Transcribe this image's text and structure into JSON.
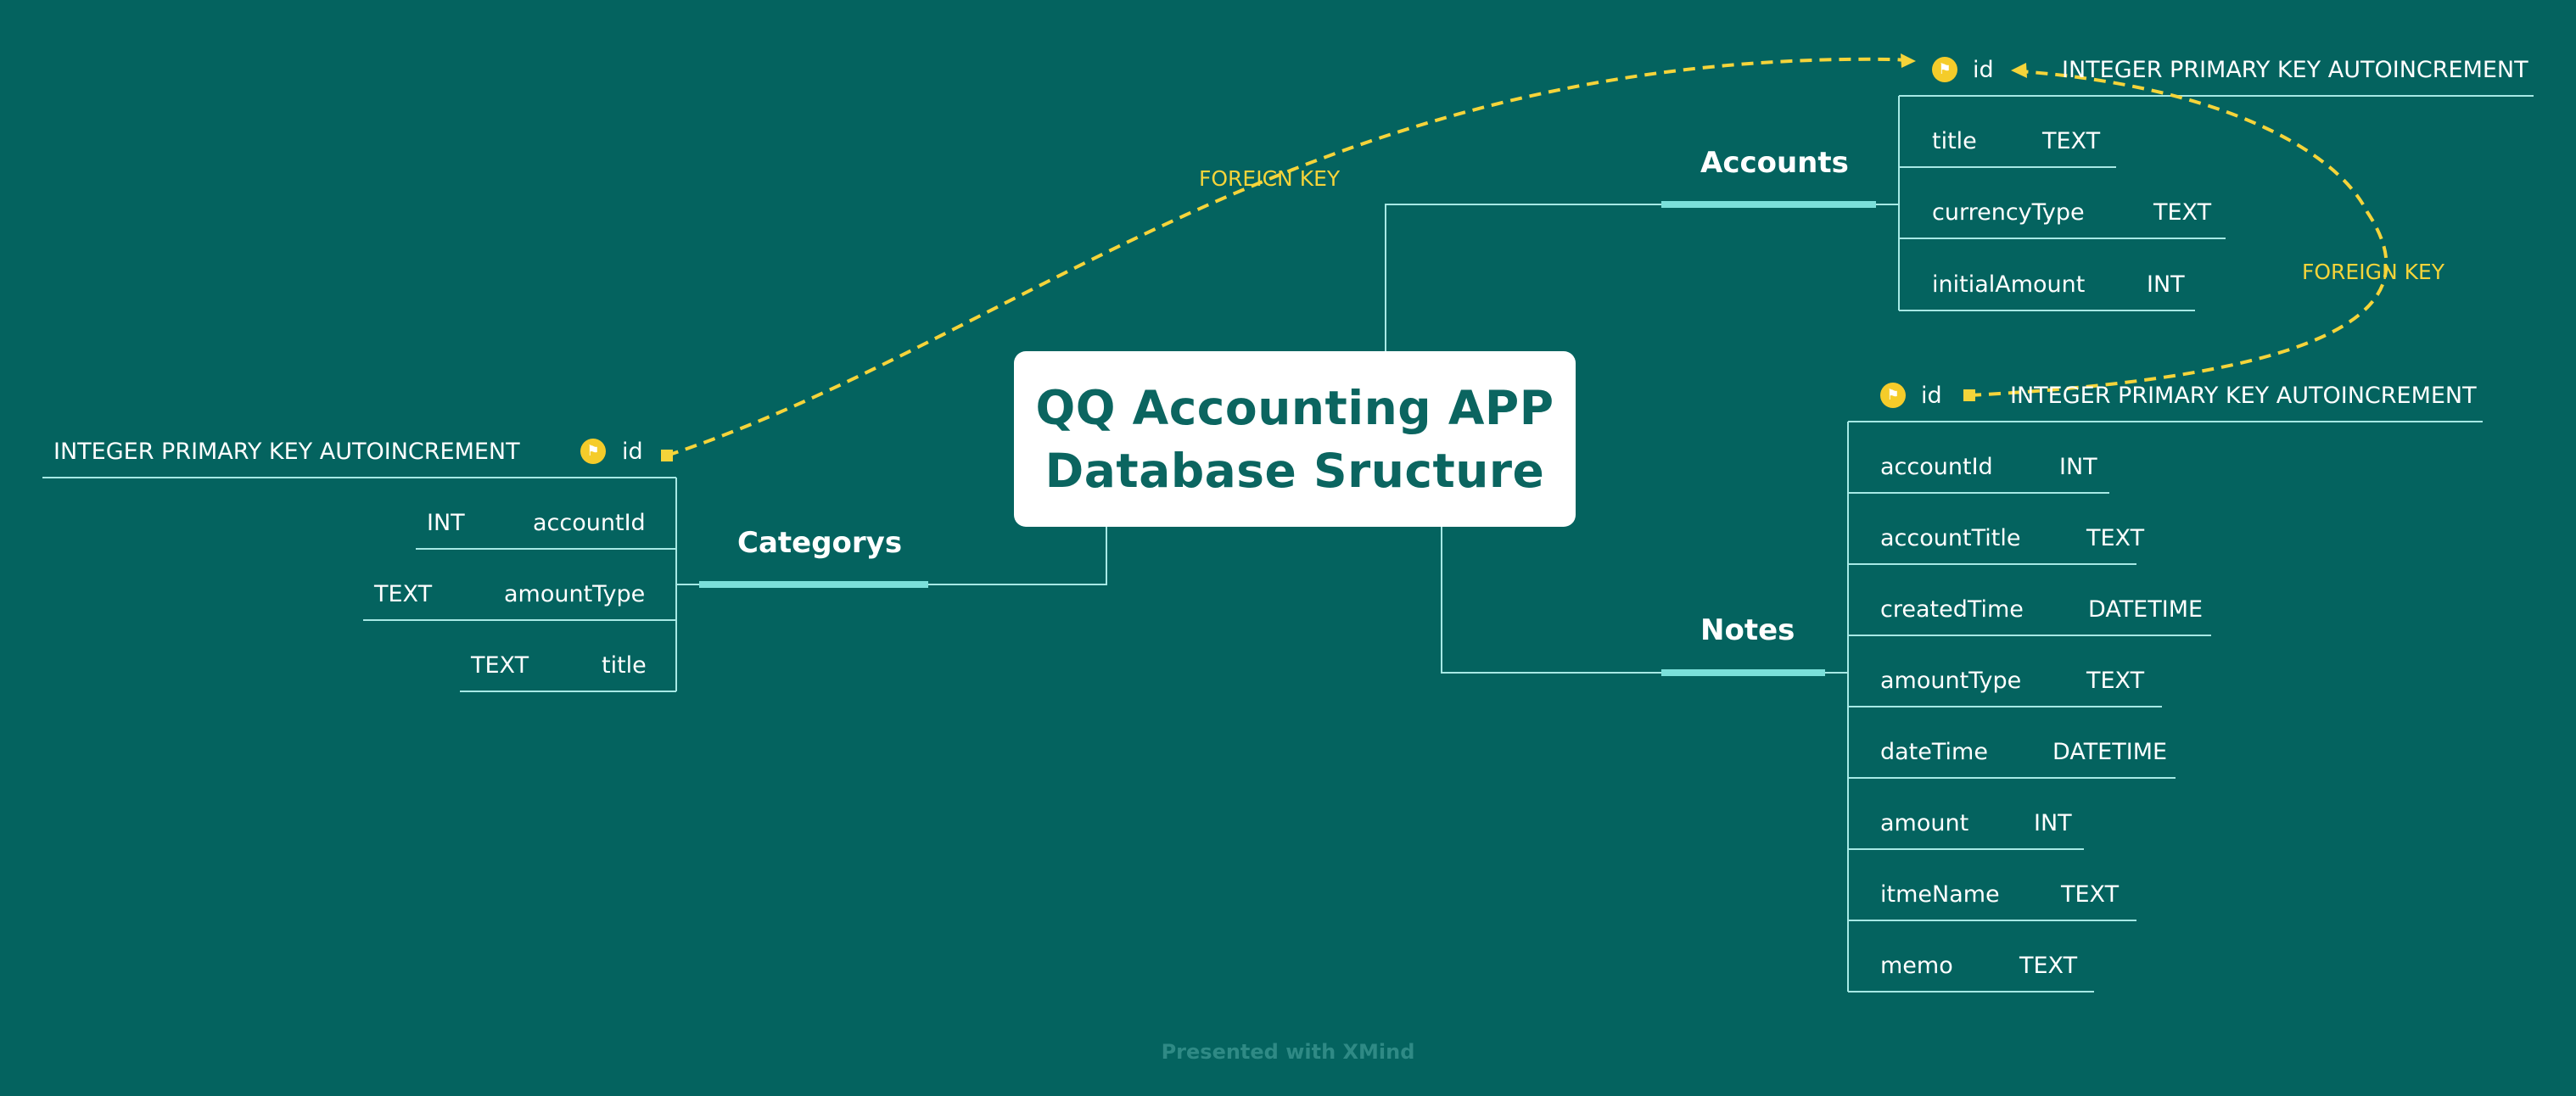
{
  "center": {
    "line1": "QQ Accounting APP",
    "line2": "Database Sructure"
  },
  "accounts": {
    "label": "Accounts",
    "id_label": "id",
    "id_type": "INTEGER PRIMARY KEY AUTOINCREMENT",
    "fields": [
      {
        "name": "title",
        "type": "TEXT"
      },
      {
        "name": "currencyType",
        "type": "TEXT"
      },
      {
        "name": "initialAmount",
        "type": "INT"
      }
    ]
  },
  "notes": {
    "label": "Notes",
    "id_label": "id",
    "id_type": "INTEGER PRIMARY KEY AUTOINCREMENT",
    "fields": [
      {
        "name": "accountId",
        "type": "INT"
      },
      {
        "name": "accountTitle",
        "type": "TEXT"
      },
      {
        "name": "createdTime",
        "type": "DATETIME"
      },
      {
        "name": "amountType",
        "type": "TEXT"
      },
      {
        "name": "dateTime",
        "type": "DATETIME"
      },
      {
        "name": "amount",
        "type": "INT"
      },
      {
        "name": "itmeName",
        "type": "TEXT"
      },
      {
        "name": "memo",
        "type": "TEXT"
      }
    ]
  },
  "categorys": {
    "label": "Categorys",
    "id_label": "id",
    "id_type": "INTEGER PRIMARY KEY AUTOINCREMENT",
    "fields": [
      {
        "name": "accountId",
        "type": "INT"
      },
      {
        "name": "amountType",
        "type": "TEXT"
      },
      {
        "name": "title",
        "type": "TEXT"
      }
    ]
  },
  "foreign_keys": {
    "left": "FOREICN KEY",
    "right": "FOREIGN KEY"
  },
  "watermark": "Presented with XMind",
  "colors": {
    "background": "#04635f",
    "branch_line": "#a7e9e5",
    "branch_bar": "#7be0da",
    "foreign_key": "#f5d43a",
    "key_icon": "#f5cc2a"
  },
  "icons": {
    "primary_key": "flag-icon"
  }
}
